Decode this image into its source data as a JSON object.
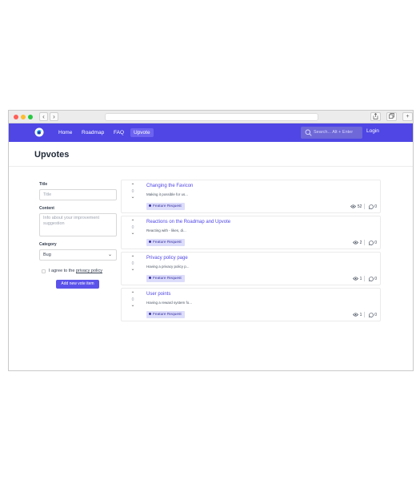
{
  "browser": {
    "back": "‹",
    "forward": "›"
  },
  "nav": {
    "items": [
      "Home",
      "Roadmap",
      "FAQ",
      "Upvote"
    ],
    "active": "Upvote",
    "search_placeholder": "Search... Alt + Enter",
    "login": "Login",
    "brand_color": "#4f46e5"
  },
  "page": {
    "title": "Upvotes"
  },
  "form": {
    "title_label": "Title",
    "title_placeholder": "Title",
    "content_label": "Content",
    "content_placeholder": "Info about your improvement suggestion",
    "category_label": "Category",
    "category_value": "Bug",
    "agree_prefix": "I agree to the",
    "agree_link": "privacy policy",
    "submit_label": "Add new vote item"
  },
  "items": [
    {
      "title": "Changing the Favicon",
      "desc": "Making it possible for us...",
      "badge": "Feature Request",
      "votes": "0",
      "views": "52",
      "comments": "0"
    },
    {
      "title": "Reactions on the Roadmap and Upvote",
      "desc": "Reacting with - likes, di...",
      "badge": "Feature Request",
      "votes": "0",
      "views": "2",
      "comments": "0"
    },
    {
      "title": "Privacy policy page",
      "desc": "Having a privacy policy p...",
      "badge": "Feature Request",
      "votes": "0",
      "views": "1",
      "comments": "0"
    },
    {
      "title": "User points",
      "desc": "Having a reward system fo...",
      "badge": "Feature Request",
      "votes": "0",
      "views": "1",
      "comments": "0"
    }
  ]
}
